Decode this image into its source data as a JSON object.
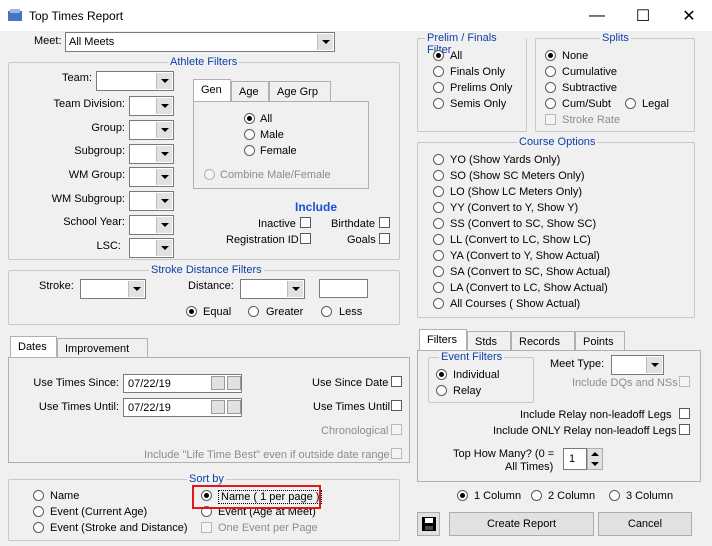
{
  "window": {
    "title": "Top Times Report",
    "minimize": "—",
    "maximize": "☐",
    "close": "✕"
  },
  "meet": {
    "label": "Meet:",
    "value": "All Meets"
  },
  "athlete_filters": {
    "title": "Athlete Filters",
    "team": "Team:",
    "team_division": "Team Division:",
    "group": "Group:",
    "subgroup": "Subgroup:",
    "wm_group": "WM Group:",
    "wm_subgroup": "WM Subgroup:",
    "school_year": "School Year:",
    "lsc": "LSC:",
    "tabs": [
      "Gen",
      "Age",
      "Age Grp"
    ],
    "gender": [
      "All",
      "Male",
      "Female"
    ],
    "combine": "Combine Male/Female",
    "include_title": "Include",
    "inactive": "Inactive",
    "birthdate": "Birthdate",
    "registration_id": "Registration ID",
    "goals": "Goals"
  },
  "stroke_distance": {
    "title": "Stroke Distance Filters",
    "stroke": "Stroke:",
    "distance": "Distance:",
    "options": [
      "Equal",
      "Greater",
      "Less"
    ]
  },
  "dates_tabs": [
    "Dates",
    "Improvement"
  ],
  "dates": {
    "since_label": "Use Times Since:",
    "since_value": "07/22/19",
    "until_label": "Use Times Until:",
    "until_value": "07/22/19",
    "use_since_date": "Use Since Date",
    "use_times_until": "Use Times Until",
    "chronological": "Chronological",
    "life_time_best": "Include \"Life Time Best\" even if outside date range"
  },
  "sort_by": {
    "title": "Sort by",
    "options": [
      "Name",
      "Event (Current Age)",
      "Event (Stroke and Distance)",
      "Name ( 1 per page )",
      "Event   (Age at Meet)"
    ],
    "one_event": "One Event per Page"
  },
  "prelim_finals": {
    "title": "Prelim / Finals Filter",
    "options": [
      "All",
      "Finals Only",
      "Prelims Only",
      "Semis Only"
    ]
  },
  "splits": {
    "title": "Splits",
    "options": [
      "None",
      "Cumulative",
      "Subtractive",
      "Cum/Subt",
      "Legal"
    ],
    "stroke_rate": "Stroke Rate"
  },
  "course_options": {
    "title": "Course Options",
    "options": [
      "YO (Show Yards Only)",
      "SO (Show SC Meters Only)",
      "LO (Show LC Meters Only)",
      "YY (Convert to Y, Show Y)",
      "SS (Convert to SC, Show SC)",
      "LL (Convert to LC, Show LC)",
      "YA (Convert to Y, Show Actual)",
      "SA (Convert to SC, Show Actual)",
      "LA (Convert to LC, Show Actual)",
      "All Courses ( Show Actual)"
    ]
  },
  "right_tabs": [
    "Filters",
    "Stds",
    "Records",
    "Points"
  ],
  "event_filters": {
    "title": "Event Filters",
    "options": [
      "Individual",
      "Relay"
    ]
  },
  "meet_type": "Meet Type:",
  "include_dqs": "Include DQs and NSs",
  "relay_nonleadoff": "Include Relay non-leadoff  Legs",
  "only_relay_nonleadoff": "Include ONLY Relay non-leadoff Legs",
  "top_how_many": {
    "label1": "Top How Many?  (0 =",
    "label2": "All Times)",
    "value": "1"
  },
  "columns": [
    "1 Column",
    "2 Column",
    "3 Column"
  ],
  "buttons": {
    "create": "Create Report",
    "cancel": "Cancel"
  },
  "colors": {
    "group_title": "#0b3fa8",
    "include_title": "#1a4fd6",
    "highlight": "#e0181b"
  }
}
